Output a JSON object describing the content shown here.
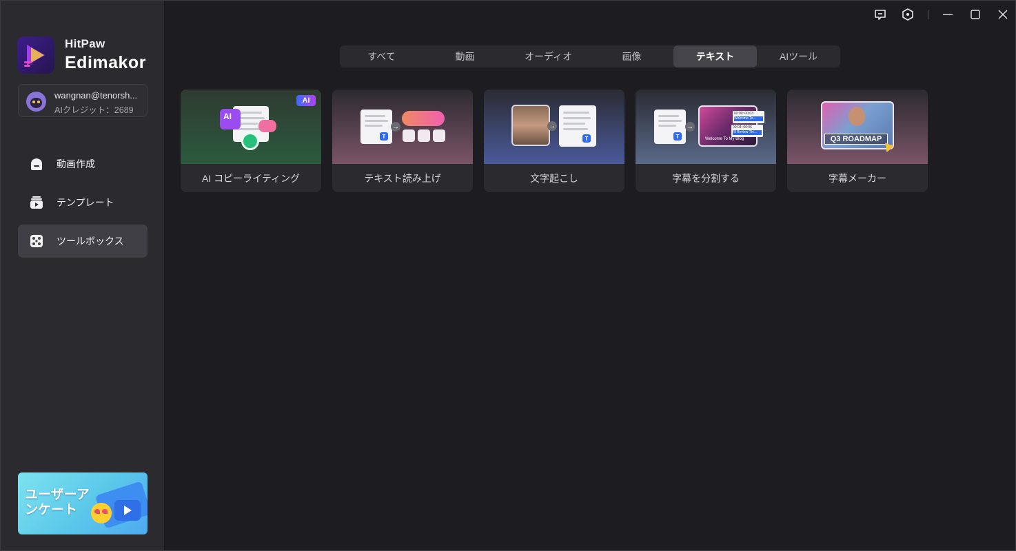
{
  "brand": {
    "small": "HitPaw",
    "big": "Edimakor"
  },
  "account": {
    "name": "wangnan@tenorsh...",
    "credits": "AIクレジット：2689"
  },
  "nav": [
    {
      "label": "動画作成",
      "icon": "home-icon"
    },
    {
      "label": "テンプレート",
      "icon": "template-icon"
    },
    {
      "label": "ツールボックス",
      "icon": "toolbox-icon",
      "active": true
    }
  ],
  "banner": {
    "text": "ユーザーアンケート"
  },
  "tabs": [
    {
      "label": "すべて"
    },
    {
      "label": "動画"
    },
    {
      "label": "オーディオ"
    },
    {
      "label": "画像"
    },
    {
      "label": "テキスト",
      "active": true
    },
    {
      "label": "AIツール"
    }
  ],
  "cards": [
    {
      "label": "AI コピーライティング",
      "badge": "AI"
    },
    {
      "label": "テキスト読み上げ"
    },
    {
      "label": "文字起こし"
    },
    {
      "label": "字幕を分割する",
      "sub1": "00:00~00:03",
      "sub2": "Welcome To...",
      "sub3": "00:04~00:06",
      "sub4": "I'll Review Thi...",
      "caption": "Welcome To My Blog"
    },
    {
      "label": "字幕メーカー",
      "caption": "Q3 ROADMAP"
    }
  ],
  "colors": {
    "accent": "#2e6bf0",
    "sidebar": "#2b2b2f",
    "background": "#1c1c21"
  }
}
